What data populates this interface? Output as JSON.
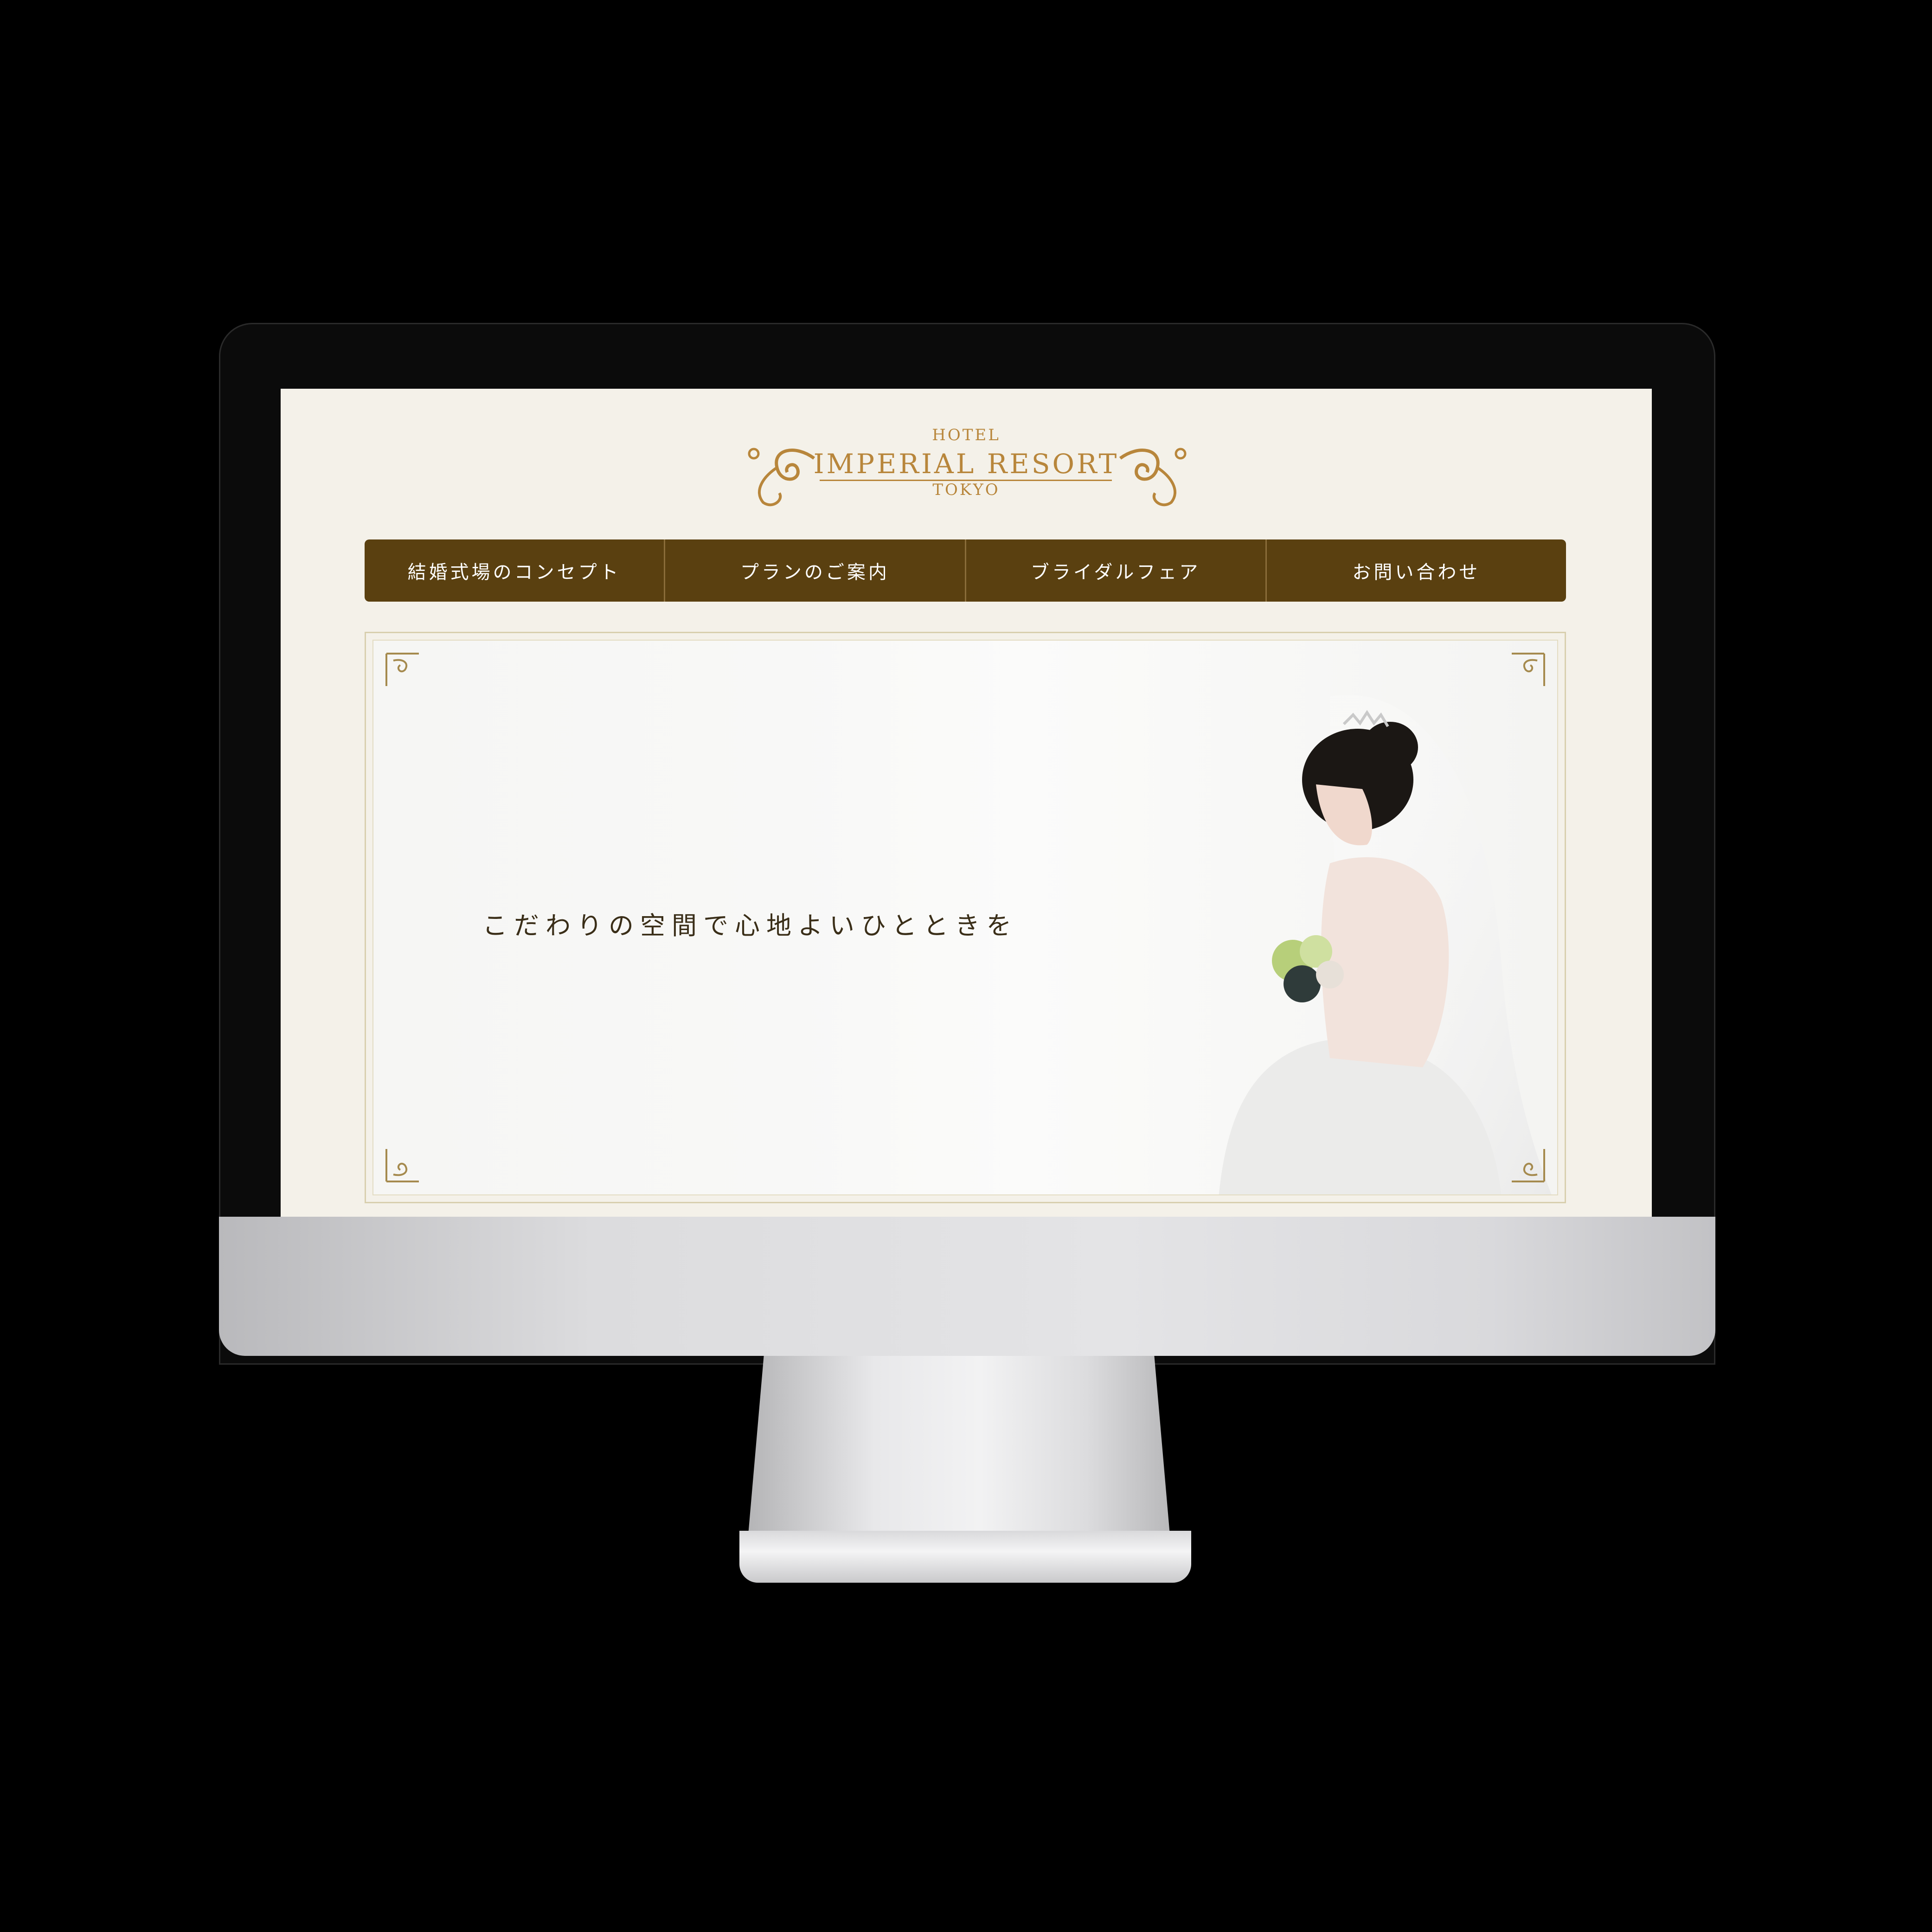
{
  "logo": {
    "top": "HOTEL",
    "main": "IMPERIAL RESORT",
    "bottom": "TOKYO"
  },
  "nav": {
    "items": [
      {
        "label": "結婚式場のコンセプト"
      },
      {
        "label": "プランのご案内"
      },
      {
        "label": "ブライダルフェア"
      },
      {
        "label": "お問い合わせ"
      }
    ]
  },
  "hero": {
    "caption": "こだわりの空間で心地よいひとときを"
  },
  "colors": {
    "nav_background": "#5a4010",
    "logo_gold": "#b8863b",
    "page_background": "#f4f1e9"
  },
  "icons": [
    "flourish-left-icon",
    "flourish-right-icon",
    "corner-ornament-icon"
  ]
}
